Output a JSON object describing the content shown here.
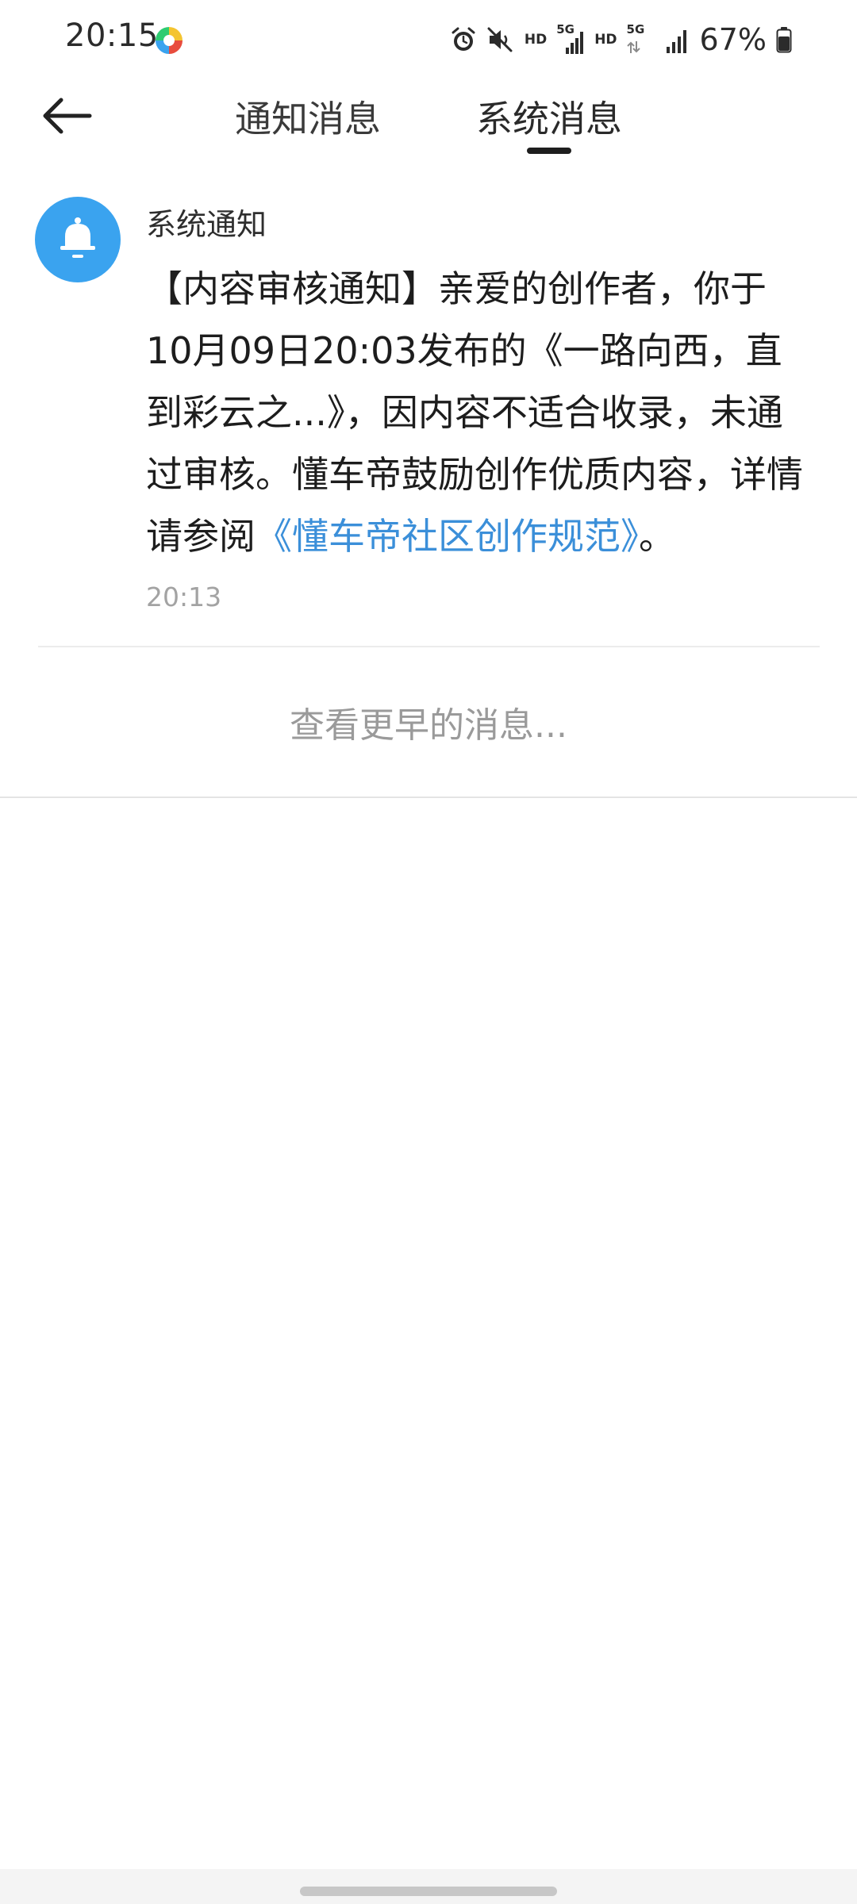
{
  "status_bar": {
    "time": "20:15",
    "hd_1": "HD",
    "net_1": "5G",
    "hd_2": "HD",
    "net_2": "5G",
    "battery": "67%",
    "icons": [
      "app-icon",
      "alarm-icon",
      "mute-icon",
      "signal-icon",
      "signal-icon",
      "battery-icon"
    ]
  },
  "header": {
    "tabs": [
      {
        "label": "通知消息",
        "active": false
      },
      {
        "label": "系统消息",
        "active": true
      }
    ]
  },
  "message": {
    "sender": "系统通知",
    "body_prefix": "【内容审核通知】亲爱的创作者，你于10月09日20:03发布的《一路向西，直到彩云之...》，因内容不适合收录，未通过审核。懂车帝鼓励创作优质内容，详情请参阅",
    "link_text": "《懂车帝社区创作规范》",
    "body_suffix": "。",
    "time": "20:13"
  },
  "load_more": "查看更早的消息...",
  "colors": {
    "accent_blue": "#3aa3ef",
    "link_blue": "#3b8fd9",
    "secondary_text": "#9a9a9a"
  }
}
